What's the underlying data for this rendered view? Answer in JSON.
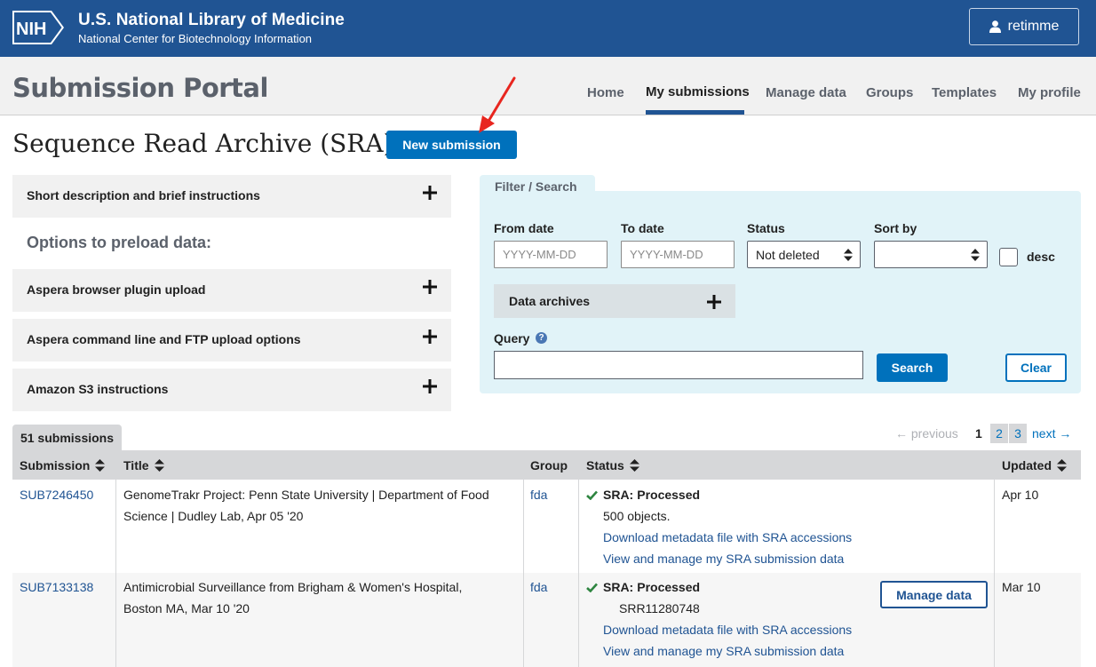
{
  "header": {
    "logo_text": "NIH",
    "org_title": "U.S. National Library of Medicine",
    "org_subtitle": "National Center for Biotechnology Information",
    "user_name": "retimme"
  },
  "portal": {
    "title": "Submission Portal",
    "nav": [
      "Home",
      "My submissions",
      "Manage data",
      "Groups",
      "Templates",
      "My profile"
    ],
    "active_nav": "My submissions"
  },
  "page": {
    "title": "Sequence Read Archive (SRA)",
    "new_submission_label": "New submission"
  },
  "accordions": {
    "short_description": "Short description and brief instructions",
    "preload_title": "Options to preload data:",
    "aspera_browser": "Aspera browser plugin upload",
    "aspera_cli": "Aspera command line and FTP upload options",
    "amazon_s3": "Amazon S3 instructions"
  },
  "filter": {
    "tab_label": "Filter / Search",
    "from_date_label": "From date",
    "from_date_placeholder": "YYYY-MM-DD",
    "to_date_label": "To date",
    "to_date_placeholder": "YYYY-MM-DD",
    "status_label": "Status",
    "status_value": "Not deleted",
    "sort_label": "Sort by",
    "sort_value": "",
    "desc_label": "desc",
    "desc_checked": false,
    "data_archives_label": "Data archives",
    "query_label": "Query",
    "help_glyph": "?",
    "query_value": "",
    "search_label": "Search",
    "clear_label": "Clear"
  },
  "results": {
    "count_label": "51 submissions",
    "pagination": {
      "previous": "← previous",
      "pages": [
        "1",
        "2",
        "3"
      ],
      "current": "1",
      "next": "next →"
    },
    "columns": [
      "Submission",
      "Title",
      "Group",
      "Status",
      "Updated"
    ],
    "rows": [
      {
        "id": "SUB7246450",
        "title_line1": "GenomeTrakr Project: Penn State University | Department of Food",
        "title_line2": "Science | Dudley Lab, Apr 05 '20",
        "group": "fda",
        "status_db": "SRA:",
        "status_value": "Processed",
        "status_detail": "500 objects.",
        "link1": "Download metadata file with SRA accessions",
        "link2": "View and manage my SRA submission data",
        "updated": "Apr 10"
      },
      {
        "id": "SUB7133138",
        "title_line1": "Antimicrobial Surveillance from Brigham & Women's Hospital,",
        "title_line2": "Boston MA, Mar 10 '20",
        "group": "fda",
        "status_db": "SRA:",
        "status_value": "Processed",
        "status_detail": "SRR11280748",
        "manage_label": "Manage data",
        "link1": "Download metadata file with SRA accessions",
        "link2": "View and manage my SRA submission data",
        "updated": "Mar 10"
      }
    ]
  },
  "colors": {
    "header_blue": "#205493",
    "primary_button": "#0071bc",
    "filter_bg": "#e1f3f8",
    "success_green": "#2e8540",
    "annotation_arrow": "#e8261f"
  },
  "icons": [
    "user-icon",
    "plus-icon",
    "sort-icon",
    "help-icon",
    "checkmark-icon",
    "select-arrows-icon",
    "annotation-arrow"
  ]
}
